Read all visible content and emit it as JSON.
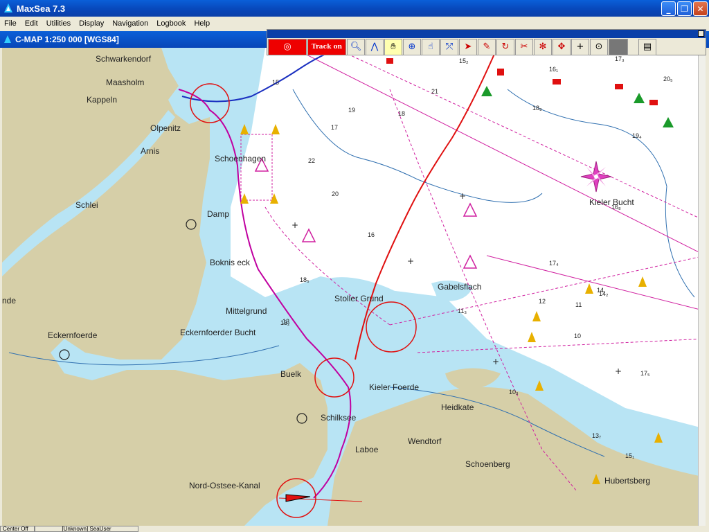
{
  "window": {
    "title": "MaxSea 7.3"
  },
  "menu": [
    "File",
    "Edit",
    "Utilities",
    "Display",
    "Navigation",
    "Logbook",
    "Help"
  ],
  "chart_window": {
    "title": "C-MAP  1:250 000 [WGS84]"
  },
  "toolbar": {
    "track_label": "Track on"
  },
  "places": [
    {
      "id": "schwarkendorf",
      "label": "Schwarkendorf"
    },
    {
      "id": "maasholm",
      "label": "Maasholm"
    },
    {
      "id": "kappeln",
      "label": "Kappeln"
    },
    {
      "id": "olpenitz",
      "label": "Olpenitz"
    },
    {
      "id": "arnis",
      "label": "Arnis"
    },
    {
      "id": "schoenhagen",
      "label": "Schoenhagen"
    },
    {
      "id": "schlei",
      "label": "Schlei"
    },
    {
      "id": "damp",
      "label": "Damp"
    },
    {
      "id": "boknis-eck",
      "label": "Boknis eck"
    },
    {
      "id": "mittelgrund",
      "label": "Mittelgrund"
    },
    {
      "id": "ende",
      "label": "nde"
    },
    {
      "id": "eckernfoerde",
      "label": "Eckernfoerde"
    },
    {
      "id": "eckernfoerder-bucht",
      "label": "Eckernfoerder Bucht"
    },
    {
      "id": "stoller-grund",
      "label": "Stoller Grund"
    },
    {
      "id": "gabelsflach",
      "label": "Gabelsflach"
    },
    {
      "id": "kieler-bucht",
      "label": "Kieler Bucht"
    },
    {
      "id": "buelk",
      "label": "Buelk"
    },
    {
      "id": "kieler-foerde",
      "label": "Kieler Foerde"
    },
    {
      "id": "heidkate",
      "label": "Heidkate"
    },
    {
      "id": "schilksee",
      "label": "Schilksee"
    },
    {
      "id": "wendtorf",
      "label": "Wendtorf"
    },
    {
      "id": "laboe",
      "label": "Laboe"
    },
    {
      "id": "schoenberg",
      "label": "Schoenberg"
    },
    {
      "id": "hubertsberg",
      "label": "Hubertsberg"
    },
    {
      "id": "nord-ostsee-kanal",
      "label": "Nord-Ostsee-Kanal"
    }
  ],
  "depths": [
    "15",
    "21",
    "19",
    "18",
    "17",
    "22",
    "20",
    "16",
    "13",
    "14",
    "12",
    "11",
    "10",
    "15₂",
    "16₁",
    "17₃",
    "20₅",
    "18₈",
    "19₄",
    "17₄",
    "13₂",
    "15₁",
    "18₅",
    "11₃",
    "17₅",
    "10₃",
    "13₇",
    "14₂",
    "16₈"
  ],
  "colors": {
    "land": "#d6cfa8",
    "shallow": "#b8e4f4",
    "deep": "#ffffff",
    "track_blue": "#1a2fc0",
    "route_red": "#e01010",
    "route_magenta": "#c000a0"
  },
  "statusbar": {
    "cell1": "Center Off",
    "cell2": "[Unknown] SeaUser"
  }
}
